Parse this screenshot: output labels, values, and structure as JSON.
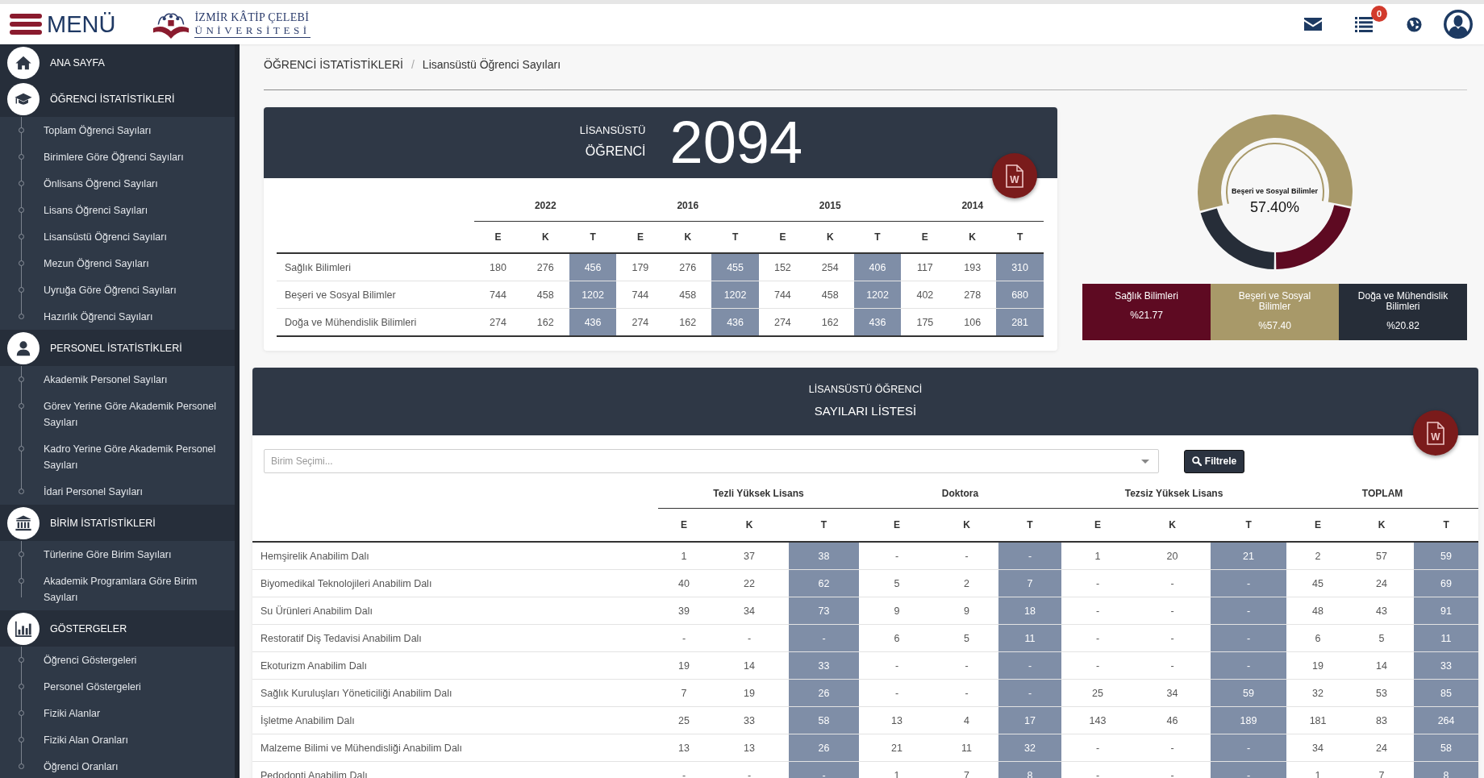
{
  "header": {
    "menu_label": "MENÜ",
    "logo_line1": "İZMİR KÂTİP ÇELEBİ",
    "logo_line2": "ÜNİVERSİTESİ",
    "notification_count": "0"
  },
  "sidebar": {
    "sections": [
      {
        "label": "ANA SAYFA"
      },
      {
        "label": "ÖĞRENCİ İSTATİSTİKLERİ",
        "items": [
          "Toplam Öğrenci Sayıları",
          "Birimlere Göre Öğrenci Sayıları",
          "Önlisans Öğrenci Sayıları",
          "Lisans Öğrenci Sayıları",
          "Lisansüstü Öğrenci Sayıları",
          "Mezun Öğrenci Sayıları",
          "Uyruğa Göre Öğrenci Sayıları",
          "Hazırlık Öğrenci Sayıları"
        ]
      },
      {
        "label": "PERSONEL İSTATİSTİKLERİ",
        "items": [
          "Akademik Personel Sayıları",
          "Görev Yerine Göre Akademik Personel Sayıları",
          "Kadro Yerine Göre Akademik Personel Sayıları",
          "İdari Personel Sayıları"
        ]
      },
      {
        "label": "BİRİM İSTATİSTİKLERİ",
        "items": [
          "Türlerine Göre Birim Sayıları",
          "Akademik Programlara Göre Birim Sayıları"
        ]
      },
      {
        "label": "GÖSTERGELER",
        "items": [
          "Öğrenci Göstergeleri",
          "Personel Göstergeleri",
          "Fiziki Alanlar",
          "Fiziki Alan Oranları",
          "Öğrenci Oranları"
        ]
      }
    ]
  },
  "breadcrumb": {
    "items": [
      "ÖĞRENCİ İSTATİSTİKLERİ",
      "Lisansüstü Öğrenci Sayıları"
    ],
    "separator": "/"
  },
  "summary": {
    "title_line1": "LİSANSÜSTÜ",
    "title_line2": "ÖĞRENCİ",
    "total": "2094",
    "export_label": "W",
    "table": {
      "groups": [
        {
          "label": "2022",
          "columns": [
            {
              "label": "E",
              "highlighted": false
            },
            {
              "label": "K",
              "highlighted": false
            },
            {
              "label": "T",
              "highlighted": true
            }
          ]
        },
        {
          "label": "2016",
          "columns": [
            {
              "label": "E",
              "highlighted": false
            },
            {
              "label": "K",
              "highlighted": false
            },
            {
              "label": "T",
              "highlighted": true
            }
          ]
        },
        {
          "label": "2015",
          "columns": [
            {
              "label": "E",
              "highlighted": false
            },
            {
              "label": "K",
              "highlighted": false
            },
            {
              "label": "T",
              "highlighted": true
            }
          ]
        },
        {
          "label": "2014",
          "columns": [
            {
              "label": "E",
              "highlighted": false
            },
            {
              "label": "K",
              "highlighted": false
            },
            {
              "label": "T",
              "highlighted": true
            }
          ]
        }
      ],
      "rows": [
        {
          "label": "Sağlık Bilimleri",
          "values": [
            "180",
            "276",
            "456",
            "179",
            "276",
            "455",
            "152",
            "254",
            "406",
            "117",
            "193",
            "310"
          ]
        },
        {
          "label": "Beşeri ve Sosyal Bilimler",
          "values": [
            "744",
            "458",
            "1202",
            "744",
            "458",
            "1202",
            "744",
            "458",
            "1202",
            "402",
            "278",
            "680"
          ]
        },
        {
          "label": "Doğa ve Mühendislik Bilimleri",
          "values": [
            "274",
            "162",
            "436",
            "274",
            "162",
            "436",
            "274",
            "162",
            "436",
            "175",
            "106",
            "281"
          ]
        }
      ]
    }
  },
  "donut": {
    "chart_data": {
      "type": "donut",
      "categories": [
        "Sağlık Bilimleri",
        "Beşeri ve Sosyal Bilimler",
        "Doğa ve Mühendislik Bilimleri"
      ],
      "values": [
        21.77,
        57.4,
        20.82
      ]
    },
    "center_label": "Beşeri ve Sosyal Bilimler",
    "center_value": "57.40%",
    "legend": [
      {
        "value": "%21.77",
        "color": "#5e0a22",
        "selected": false
      },
      {
        "value": "%57.40",
        "color": "#a89969",
        "selected": true
      },
      {
        "value": "%20.82",
        "color": "#262d38",
        "selected": false
      }
    ]
  },
  "list": {
    "title_line1": "LİSANSÜSTÜ ÖĞRENCİ",
    "title_line2": "SAYILARI LİSTESİ",
    "export_label": "W",
    "filter": {
      "placeholder": "Birim Seçimi...",
      "button": "Filtrele"
    },
    "table": {
      "groups": [
        {
          "label": "Tezli Yüksek Lisans",
          "columns": [
            {
              "label": "E",
              "highlighted": false
            },
            {
              "label": "K",
              "highlighted": false
            },
            {
              "label": "T",
              "highlighted": true
            }
          ]
        },
        {
          "label": "Doktora",
          "columns": [
            {
              "label": "E",
              "highlighted": false
            },
            {
              "label": "K",
              "highlighted": false
            },
            {
              "label": "T",
              "highlighted": true
            }
          ]
        },
        {
          "label": "Tezsiz Yüksek Lisans",
          "columns": [
            {
              "label": "E",
              "highlighted": false
            },
            {
              "label": "K",
              "highlighted": false
            },
            {
              "label": "T",
              "highlighted": true
            }
          ]
        },
        {
          "label": "TOPLAM",
          "columns": [
            {
              "label": "E",
              "highlighted": false
            },
            {
              "label": "K",
              "highlighted": false
            },
            {
              "label": "T",
              "highlighted": true
            }
          ]
        }
      ],
      "rows": [
        {
          "label": "Hemşirelik Anabilim Dalı",
          "values": [
            "1",
            "37",
            "38",
            "-",
            "-",
            "-",
            "1",
            "20",
            "21",
            "2",
            "57",
            "59"
          ]
        },
        {
          "label": "Biyomedikal Teknolojileri Anabilim Dalı",
          "values": [
            "40",
            "22",
            "62",
            "5",
            "2",
            "7",
            "-",
            "-",
            "-",
            "45",
            "24",
            "69"
          ]
        },
        {
          "label": "Su Ürünleri Anabilim Dalı",
          "values": [
            "39",
            "34",
            "73",
            "9",
            "9",
            "18",
            "-",
            "-",
            "-",
            "48",
            "43",
            "91"
          ]
        },
        {
          "label": "Restoratif Diş Tedavisi Anabilim Dalı",
          "values": [
            "-",
            "-",
            "-",
            "6",
            "5",
            "11",
            "-",
            "-",
            "-",
            "6",
            "5",
            "11"
          ]
        },
        {
          "label": "Ekoturizm Anabilim Dalı",
          "values": [
            "19",
            "14",
            "33",
            "-",
            "-",
            "-",
            "-",
            "-",
            "-",
            "19",
            "14",
            "33"
          ]
        },
        {
          "label": "Sağlık Kuruluşları Yöneticiliği Anabilim Dalı",
          "values": [
            "7",
            "19",
            "26",
            "-",
            "-",
            "-",
            "25",
            "34",
            "59",
            "32",
            "53",
            "85"
          ]
        },
        {
          "label": "İşletme Anabilim Dalı",
          "values": [
            "25",
            "33",
            "58",
            "13",
            "4",
            "17",
            "143",
            "46",
            "189",
            "181",
            "83",
            "264"
          ]
        },
        {
          "label": "Malzeme Bilimi ve Mühendisliği Anabilim Dalı",
          "values": [
            "13",
            "13",
            "26",
            "21",
            "11",
            "32",
            "-",
            "-",
            "-",
            "34",
            "24",
            "58"
          ]
        },
        {
          "label": "Pedodonti Anabilim Dalı",
          "values": [
            "-",
            "-",
            "-",
            "1",
            "7",
            "8",
            "-",
            "-",
            "-",
            "1",
            "7",
            "8"
          ]
        }
      ]
    }
  }
}
